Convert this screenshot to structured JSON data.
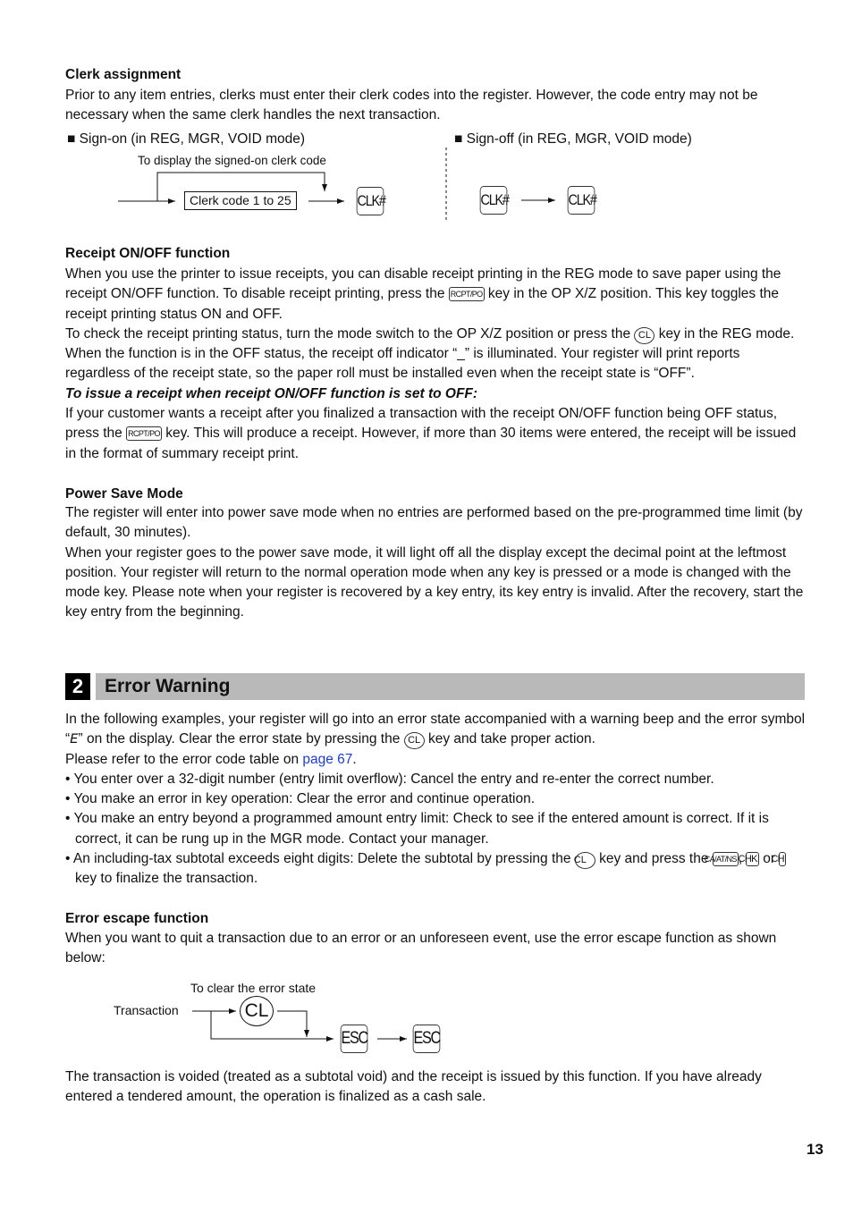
{
  "clerk": {
    "heading": "Clerk assignment",
    "para": "Prior to any item entries, clerks must enter their clerk codes into the register.  However, the code entry may not be necessary when the same clerk handles the next transaction.",
    "signon_label": "■ Sign-on (in REG, MGR, VOID mode)",
    "signoff_label": "■ Sign-off (in REG, MGR, VOID mode)",
    "display_note": "To display the signed-on clerk code",
    "code_box": "Clerk code 1 to 25",
    "clk_key": "CLK#"
  },
  "receipt": {
    "heading": "Receipt ON/OFF function",
    "p1a": "When you use the printer to issue receipts, you can disable receipt printing in the REG mode to save paper using the receipt ON/OFF function. To disable receipt printing, press the",
    "p1b": "key in the OP X/Z position.  This key toggles the receipt printing status ON and OFF.",
    "p2a": "To check the receipt printing status, turn the mode switch to the OP X/Z position or press the",
    "p2b": "key in the REG mode. When the function is in the OFF status, the receipt off indicator “_” is illuminated.  Your register will print reports regardless of the receipt state, so the paper roll must be installed even when the receipt state is “OFF”.",
    "subheading": "To issue a receipt when receipt ON/OFF function is set to OFF:",
    "p3a": "If your customer wants a receipt after you finalized a transaction with the receipt ON/OFF function being OFF status, press the",
    "p3b": "key.  This will produce a receipt.  However, if more than 30 items were entered, the receipt will be issued in the format of summary receipt print.",
    "rcpt_key": "RCPT/PO",
    "cl_key": "CL"
  },
  "power": {
    "heading": "Power Save Mode",
    "p1": "The register will enter into power save mode when no entries are performed based on the pre-programmed time limit (by default, 30 minutes).",
    "p2": "When your register goes to the power save mode, it will light off all the display except the decimal point at the leftmost position. Your register will return to the normal operation mode when any key is pressed or a mode is changed with the mode key. Please note when your register is recovered by a key entry, its key entry is invalid. After the recovery, start the key entry from the beginning."
  },
  "section": {
    "number": "2",
    "title": "Error Warning"
  },
  "error": {
    "p1a": "In the following examples, your register will go into an error state accompanied with a warning beep and the error symbol “",
    "symbol": "E",
    "p1b": "” on the display.  Clear the error state by pressing the",
    "p1c": "key and take proper action.",
    "p2a": "Please refer to the error code table on",
    "link": "page 67",
    "p2b": ".",
    "bullets": [
      "• You enter over a 32-digit number (entry limit overflow): Cancel the entry and re-enter the correct number.",
      "• You make an error in key operation: Clear the error and continue operation.",
      "• You make an entry beyond a programmed amount entry limit: Check to see if the entered amount is correct.  If it is correct, it can be rung up in the MGR mode.  Contact your manager."
    ],
    "b4a": "• An including-tax subtotal exceeds eight digits: Delete the subtotal by pressing the",
    "b4b": "key and press the",
    "b4c": ",",
    "b4d": "or",
    "b4e": "key to finalize the transaction.",
    "ca_key": "CA/AT/NS",
    "chk_key": "CHK",
    "ch_key": "CH"
  },
  "escape": {
    "heading": "Error escape function",
    "para": "When you want to quit a transaction due to an error or an unforeseen event, use the error escape function as shown below:",
    "clear_note": "To clear the error state",
    "transaction_label": "Transaction",
    "cl_key": "CL",
    "esc_key": "ESC",
    "after": "The transaction is voided (treated as a subtotal void) and the receipt is issued by this function.  If you have already entered a tendered amount, the operation is finalized as a cash sale."
  },
  "footer": {
    "page_number": "13"
  }
}
